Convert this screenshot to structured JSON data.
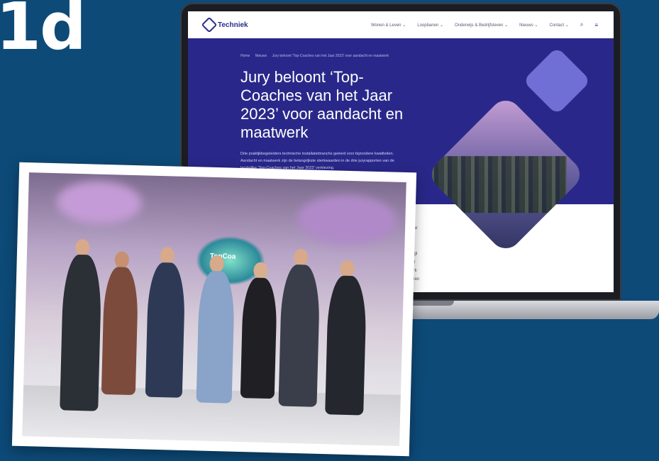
{
  "page": {
    "heading_fragment": "1d",
    "background_color": "#0d4a78"
  },
  "laptop": {
    "site": {
      "logo_text": "Techniek",
      "nav_items": [
        "Wonen & Leven",
        "Loopbanen",
        "Onderwijs & Bedrijfsleven",
        "Nieuws",
        "Contact"
      ],
      "breadcrumb": [
        "Home",
        "Nieuws",
        "Jury beloont 'Top-Coaches van het Jaar 2023' voor aandacht en maatwerk"
      ],
      "title": "Jury beloont ‘Top-Coaches van het Jaar 2023’ voor aandacht en maatwerk",
      "intro": "Drie praktijkbegeleiders technische installatiebranche geëerd voor bijzondere kwaliteiten. Aandacht en maatwerk zijn de belangrijkste sterkwaarden in de drie juryrapporten van de landelijke 'Top-Coaches van het Jaar 2023' verkiezing.",
      "side_text": [
        "maar",
        "ee",
        "zit",
        "oorgi",
        "t tot",
        "werk",
        "waren"
      ],
      "accent_color": "#29288a",
      "diamond_color": "#6f6fd6"
    }
  },
  "photo": {
    "screen_label": "TopCoa"
  }
}
